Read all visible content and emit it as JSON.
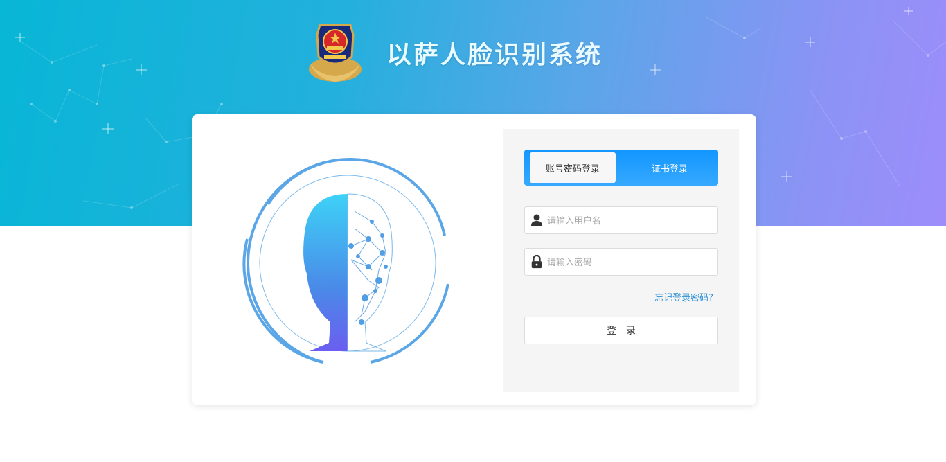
{
  "header": {
    "system_title": "以萨人脸识别系统",
    "emblem_icon": "police-emblem-icon"
  },
  "login": {
    "tabs": [
      {
        "label": "账号密码登录",
        "active": true
      },
      {
        "label": "证书登录",
        "active": false
      }
    ],
    "username": {
      "placeholder": "请输入用户名",
      "value": "",
      "icon": "user-icon"
    },
    "password": {
      "placeholder": "请输入密码",
      "value": "",
      "icon": "lock-icon"
    },
    "forgot_label": "忘记登录密码?",
    "submit_label": "登　录"
  },
  "illustration": {
    "icon": "face-recognition-icon"
  },
  "colors": {
    "hero_start": "#08b6d6",
    "hero_end": "#9d8dfb",
    "tab_blue": "#1296ff",
    "link_blue": "#2a8fd6",
    "panel_bg": "#f5f5f5"
  }
}
